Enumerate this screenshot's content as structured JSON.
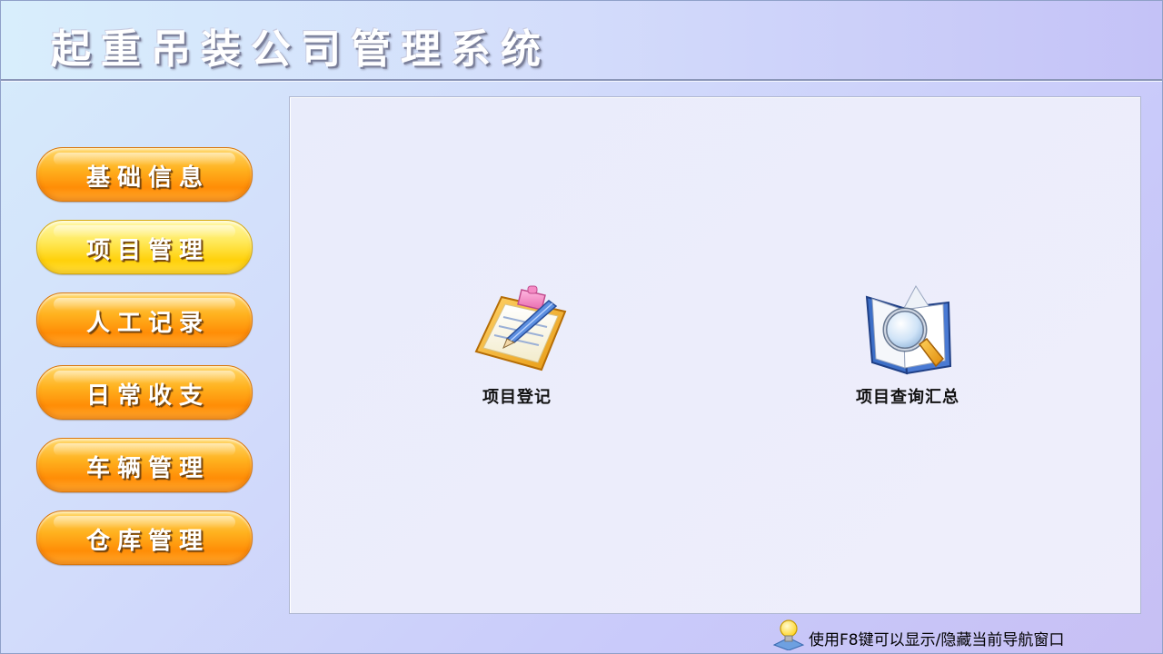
{
  "header": {
    "title": "起重吊装公司管理系统"
  },
  "sidebar": {
    "items": [
      {
        "label": "基础信息",
        "active": false
      },
      {
        "label": "项目管理",
        "active": true
      },
      {
        "label": "人工记录",
        "active": false
      },
      {
        "label": "日常收支",
        "active": false
      },
      {
        "label": "车辆管理",
        "active": false
      },
      {
        "label": "仓库管理",
        "active": false
      }
    ]
  },
  "main": {
    "functions": [
      {
        "label": "项目登记",
        "icon": "clipboard-pencil-icon"
      },
      {
        "label": "项目查询汇总",
        "icon": "book-magnifier-icon"
      }
    ]
  },
  "status": {
    "hint": "使用F8键可以显示/隐藏当前导航窗口",
    "icon": "lightbulb-icon"
  },
  "colors": {
    "nav_button": "#ff9a12",
    "nav_button_active": "#ffe23a",
    "background_start": "#d6ecfb",
    "background_end": "#c7bff4"
  }
}
